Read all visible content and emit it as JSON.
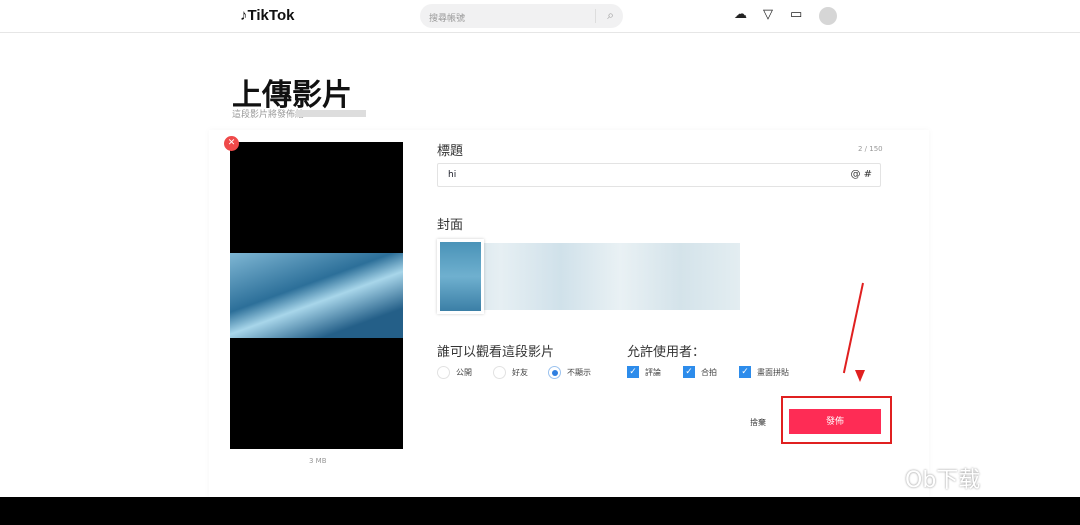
{
  "header": {
    "logo": "TikTok",
    "search_placeholder": "搜尋帳號",
    "icons": [
      "upload-icon",
      "inbox-icon",
      "message-icon",
      "avatar"
    ]
  },
  "page": {
    "title": "上傳影片",
    "subtitle": "這段影片將發佈給"
  },
  "video": {
    "size": "3 MB"
  },
  "caption": {
    "label": "標題",
    "count": "2 / 150",
    "value": "hi",
    "tools": "@  #"
  },
  "cover": {
    "label": "封面"
  },
  "privacy": {
    "label": "誰可以觀看這段影片",
    "options": [
      {
        "label": "公開",
        "selected": false
      },
      {
        "label": "好友",
        "selected": false
      },
      {
        "label": "不顯示",
        "selected": true
      }
    ]
  },
  "allow": {
    "label": "允許使用者：",
    "options": [
      {
        "label": "評論",
        "checked": true
      },
      {
        "label": "合拍",
        "checked": true
      },
      {
        "label": "畫面拼貼",
        "checked": true
      }
    ]
  },
  "actions": {
    "discard": "捨棄",
    "post": "發佈"
  },
  "watermark": "Ob下载",
  "colors": {
    "accent": "#fe2c55",
    "annotation": "#e02020"
  }
}
